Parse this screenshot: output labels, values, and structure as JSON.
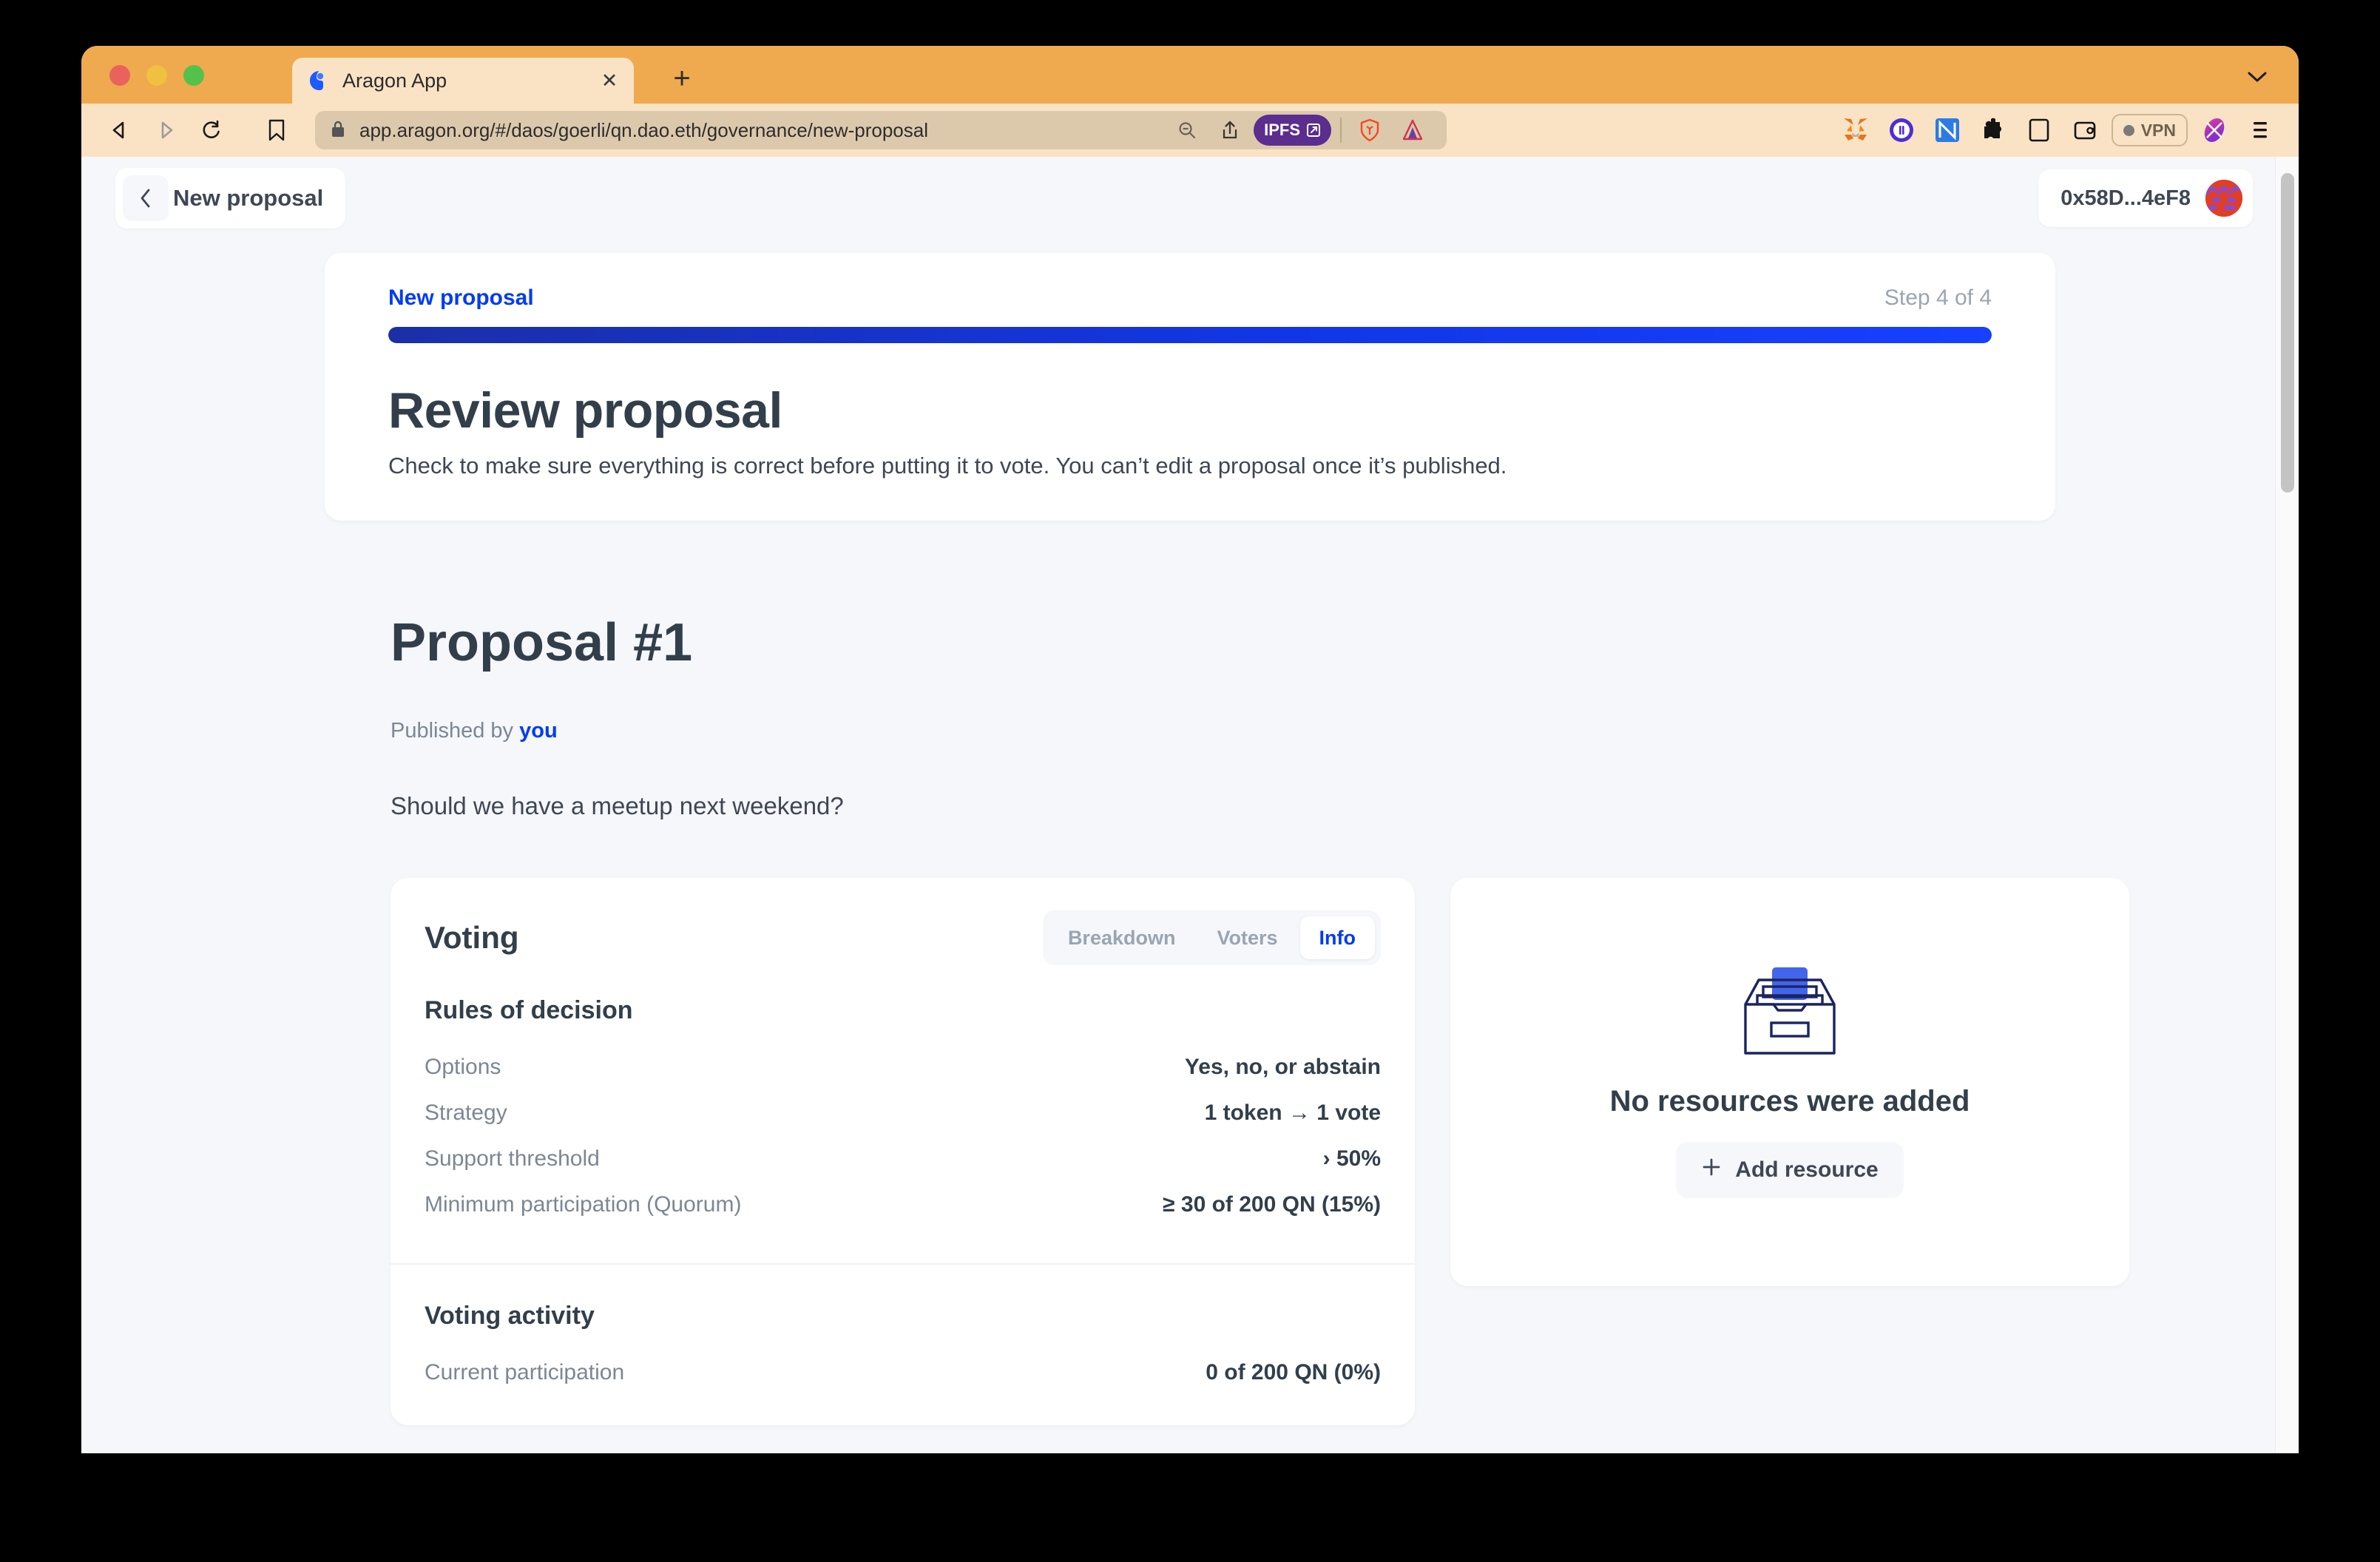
{
  "browser": {
    "tab": {
      "title": "Aragon App",
      "favicon": "aragon-logo-icon",
      "close": "✕"
    },
    "new_tab": "+",
    "url": "app.aragon.org/#/daos/goerli/qn.dao.eth/governance/new-proposal",
    "ipfs_badge": "IPFS",
    "vpn_label": "VPN",
    "traffic_lights": [
      "close",
      "minimize",
      "zoom"
    ]
  },
  "app": {
    "back_label": "New proposal",
    "wallet_address": "0x58D...4eF8"
  },
  "stepper": {
    "label": "New proposal",
    "count": "Step 4 of 4",
    "progress_percent": 100
  },
  "review": {
    "title": "Review proposal",
    "subtitle": "Check to make sure everything is correct before putting it to vote. You can’t edit a proposal once it’s published."
  },
  "proposal": {
    "title": "Proposal #1",
    "published_prefix": "Published by",
    "published_by": "you",
    "summary": "Should we have a meetup next weekend?"
  },
  "voting": {
    "title": "Voting",
    "tabs": [
      {
        "label": "Breakdown",
        "active": false
      },
      {
        "label": "Voters",
        "active": false
      },
      {
        "label": "Info",
        "active": true
      }
    ],
    "rules_title": "Rules of decision",
    "rules": [
      {
        "key": "Options",
        "value": "Yes, no, or abstain"
      },
      {
        "key": "Strategy",
        "value": "1 token → 1 vote"
      },
      {
        "key": "Support threshold",
        "value": "› 50%"
      },
      {
        "key": "Minimum participation (Quorum)",
        "value": "≥ 30 of 200 QN (15%)"
      }
    ],
    "activity_title": "Voting activity",
    "activity": [
      {
        "key": "Current participation",
        "value": "0 of 200 QN (0%)"
      }
    ]
  },
  "resources": {
    "illustration": "file-drawer-illustration",
    "empty_title": "No resources were added",
    "add_label": "Add resource",
    "add_icon": "plus-icon"
  },
  "colors": {
    "accent": "#003BF5",
    "title_bar": "#EFA94E",
    "toolbar": "#FAE3C4",
    "page_bg": "#F5F7FA",
    "heading": "#323F4B",
    "muted": "#7B8794"
  }
}
